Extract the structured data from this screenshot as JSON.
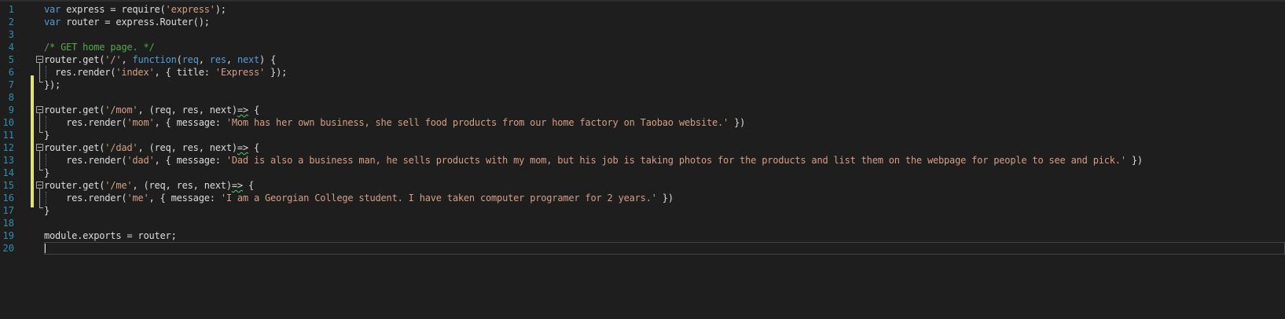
{
  "editor": {
    "colors": {
      "background": "#1e1e1e",
      "line_number": "#2b91af",
      "keyword": "#569cd6",
      "string": "#d69d85",
      "comment": "#57a64a",
      "text": "#dcdcdc",
      "change_marker": "#e3e36f"
    },
    "line_numbers": [
      "1",
      "2",
      "3",
      "4",
      "5",
      "6",
      "7",
      "8",
      "9",
      "10",
      "11",
      "12",
      "13",
      "14",
      "15",
      "16",
      "17",
      "18",
      "19",
      "20"
    ],
    "lines": [
      {
        "kw1": "var",
        "t1": " express = require(",
        "s1": "'express'",
        "t2": ");"
      },
      {
        "kw1": "var",
        "t1": " router = express.Router();"
      },
      {},
      {
        "c1": "/* GET home page. */"
      },
      {
        "t1": "router.get(",
        "s1": "'/'",
        "t2": ", ",
        "kw1": "function",
        "t3": "(",
        "kw2": "req",
        "t4": ", ",
        "kw3": "res",
        "t5": ", ",
        "kw4": "next",
        "t6": ") {"
      },
      {
        "t1": "  res.render(",
        "s1": "'index'",
        "t2": ", { title: ",
        "s2": "'Express'",
        "t3": " });"
      },
      {
        "t1": "});"
      },
      {},
      {
        "t1": "router.get(",
        "s1": "'/mom'",
        "t2": ", (req, res, next)",
        "sq1": "=>",
        "t3": " {"
      },
      {
        "t1": "    res.render(",
        "s1": "'mom'",
        "t2": ", { message: ",
        "s2": "'Mom has her own business, she sell food products from our home factory on Taobao website.'",
        "t3": " })"
      },
      {
        "t1": "}"
      },
      {
        "t1": "router.get(",
        "s1": "'/dad'",
        "t2": ", (req, res, next)",
        "sq1": "=>",
        "t3": " {"
      },
      {
        "t1": "    res.render(",
        "s1": "'dad'",
        "t2": ", { message: ",
        "s2": "'Dad is also a business man, he sells products with my mom, but his job is taking photos for the products and list them on the webpage for people to see and pick.'",
        "t3": " })"
      },
      {
        "t1": "}"
      },
      {
        "t1": "router.get(",
        "s1": "'/me'",
        "t2": ", (req, res, next)",
        "sq1": "=>",
        "t3": " {"
      },
      {
        "t1": "    res.render(",
        "s1": "'me'",
        "t2": ", { message: ",
        "s2": "'I am a Georgian College student. I have taken computer programer for 2 years.'",
        "t3": " })"
      },
      {
        "t1": "}"
      },
      {},
      {
        "t1": "module.exports = router;"
      },
      {}
    ]
  }
}
